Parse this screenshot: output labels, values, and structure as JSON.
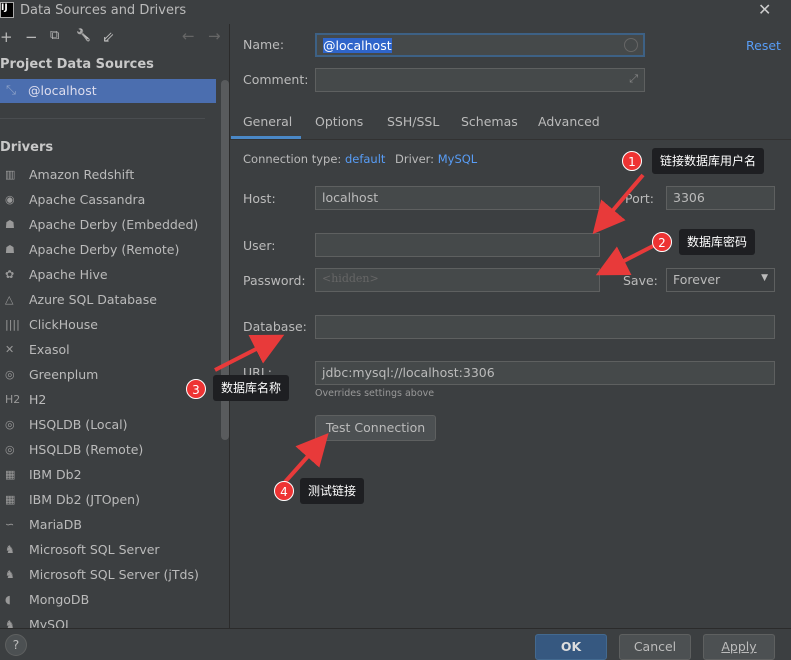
{
  "window": {
    "title": "Data Sources and Drivers",
    "logo": "IJ"
  },
  "toolbar": {
    "add": "+",
    "remove": "−",
    "copy": "⧉",
    "settings": "🔧",
    "import": "⇙",
    "back": "←",
    "forward": "→"
  },
  "sidebar": {
    "project_header": "Project Data Sources",
    "selected": "@localhost",
    "drivers_header": "Drivers",
    "drivers": [
      "Amazon Redshift",
      "Apache Cassandra",
      "Apache Derby (Embedded)",
      "Apache Derby (Remote)",
      "Apache Hive",
      "Azure SQL Database",
      "ClickHouse",
      "Exasol",
      "Greenplum",
      "H2",
      "HSQLDB (Local)",
      "HSQLDB (Remote)",
      "IBM Db2",
      "IBM Db2 (JTOpen)",
      "MariaDB",
      "Microsoft SQL Server",
      "Microsoft SQL Server (jTds)",
      "MongoDB",
      "MySQL"
    ]
  },
  "form": {
    "name_label": "Name:",
    "name_value": "@localhost",
    "reset": "Reset",
    "comment_label": "Comment:",
    "comment_value": "",
    "tabs": [
      "General",
      "Options",
      "SSH/SSL",
      "Schemas",
      "Advanced"
    ],
    "active_tab": "General",
    "conn_type_label": "Connection type:",
    "conn_type": "default",
    "driver_label": "Driver:",
    "driver": "MySQL",
    "host_label": "Host:",
    "host": "localhost",
    "port_label": "Port:",
    "port": "3306",
    "user_label": "User:",
    "user": "",
    "password_label": "Password:",
    "password_placeholder": "<hidden>",
    "save_label": "Save:",
    "save_value": "Forever",
    "database_label": "Database:",
    "database": "",
    "url_label": "URL:",
    "url": "jdbc:mysql://localhost:3306",
    "url_hint": "Overrides settings above",
    "test_button": "Test Connection"
  },
  "annotations": [
    {
      "num": "1",
      "text": "链接数据库用户名"
    },
    {
      "num": "2",
      "text": "数据库密码"
    },
    {
      "num": "3",
      "text": "数据库名称"
    },
    {
      "num": "4",
      "text": "测试链接"
    }
  ],
  "annotation_color": "#e83a3a",
  "footer": {
    "help": "?",
    "ok": "OK",
    "cancel": "Cancel",
    "apply": "Apply"
  }
}
